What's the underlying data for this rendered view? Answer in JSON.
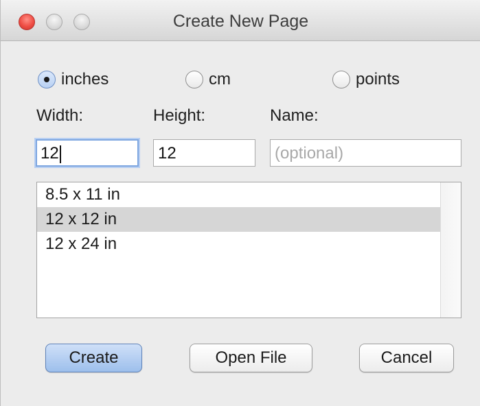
{
  "window": {
    "title": "Create New Page"
  },
  "units": {
    "options": [
      {
        "label": "inches",
        "checked": true
      },
      {
        "label": "cm",
        "checked": false
      },
      {
        "label": "points",
        "checked": false
      }
    ]
  },
  "fields": {
    "width_label": "Width:",
    "width_value": "12",
    "height_label": "Height:",
    "height_value": "12",
    "name_label": "Name:",
    "name_placeholder": "(optional)"
  },
  "page_sizes": {
    "items": [
      "8.5 x 11 in",
      "12 x 12 in",
      "12 x 24 in"
    ],
    "selected_index": 1
  },
  "buttons": {
    "create": "Create",
    "open_file": "Open File",
    "cancel": "Cancel"
  },
  "colors": {
    "default_button": "#9dbfec",
    "focus_ring": "#7ea6e0",
    "selected_row": "#d6d6d6",
    "close_button": "#ef4d44"
  }
}
